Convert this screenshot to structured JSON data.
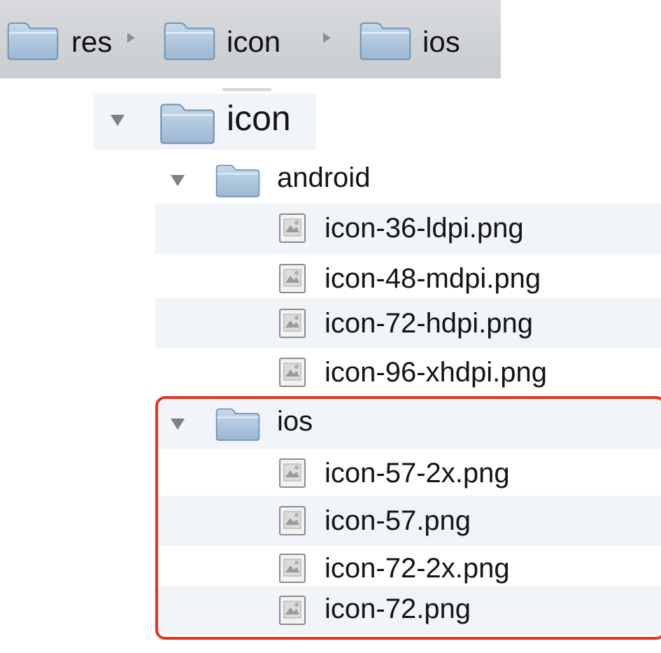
{
  "breadcrumb": {
    "items": [
      {
        "label": "res",
        "icon": "folder-icon"
      },
      {
        "label": "icon",
        "icon": "folder-icon"
      },
      {
        "label": "ios",
        "icon": "folder-icon"
      }
    ],
    "separator_icon": "right-triangle-icon"
  },
  "tree": {
    "root": {
      "label": "icon",
      "expanded": true
    },
    "android": {
      "label": "android",
      "expanded": true,
      "files": [
        "icon-36-ldpi.png",
        "icon-48-mdpi.png",
        "icon-72-hdpi.png",
        "icon-96-xhdpi.png"
      ]
    },
    "ios": {
      "label": "ios",
      "expanded": true,
      "highlighted": true,
      "files": [
        "icon-57-2x.png",
        "icon-57.png",
        "icon-72-2x.png",
        "icon-72.png"
      ]
    }
  },
  "colors": {
    "highlight": "#e8331c",
    "folder": "#a9c3dc",
    "row_alt": "#f1f4f9",
    "pathbar": "#cfd2d6"
  }
}
